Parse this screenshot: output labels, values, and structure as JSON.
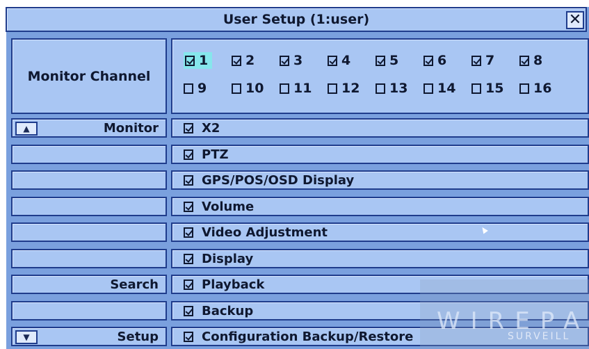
{
  "dialog": {
    "title": "User Setup (1:user)",
    "close_glyph": "✕"
  },
  "monitor_channel": {
    "label": "Monitor Channel",
    "channels": [
      {
        "label": "1",
        "checked": true,
        "selected": true
      },
      {
        "label": "2",
        "checked": true
      },
      {
        "label": "3",
        "checked": true
      },
      {
        "label": "4",
        "checked": true
      },
      {
        "label": "5",
        "checked": true
      },
      {
        "label": "6",
        "checked": true
      },
      {
        "label": "7",
        "checked": true
      },
      {
        "label": "8",
        "checked": true
      },
      {
        "label": "9",
        "checked": false
      },
      {
        "label": "10",
        "checked": false
      },
      {
        "label": "11",
        "checked": false
      },
      {
        "label": "12",
        "checked": false
      },
      {
        "label": "13",
        "checked": false
      },
      {
        "label": "14",
        "checked": false
      },
      {
        "label": "15",
        "checked": false
      },
      {
        "label": "16",
        "checked": false
      }
    ]
  },
  "rows": [
    {
      "category": "Monitor",
      "permission": "X2",
      "checked": true,
      "arrow": "up-arrow-icon"
    },
    {
      "category": "",
      "permission": "PTZ",
      "checked": true
    },
    {
      "category": "",
      "permission": "GPS/POS/OSD Display",
      "checked": true
    },
    {
      "category": "",
      "permission": "Volume",
      "checked": true
    },
    {
      "category": "",
      "permission": "Video Adjustment",
      "checked": true
    },
    {
      "category": "",
      "permission": "Display",
      "checked": true
    },
    {
      "category": "Search",
      "permission": "Playback",
      "checked": true
    },
    {
      "category": "",
      "permission": "Backup",
      "checked": true
    },
    {
      "category": "Setup",
      "permission": "Configuration Backup/Restore",
      "checked": true,
      "arrow": "down-arrow-icon"
    }
  ],
  "watermark": {
    "line1": "WIREPA",
    "line2": "SURVEILL"
  },
  "colors": {
    "panel": "#a9c6f3",
    "border": "#1f3c8c",
    "selected": "#86e6ec",
    "text": "#0f1830"
  }
}
